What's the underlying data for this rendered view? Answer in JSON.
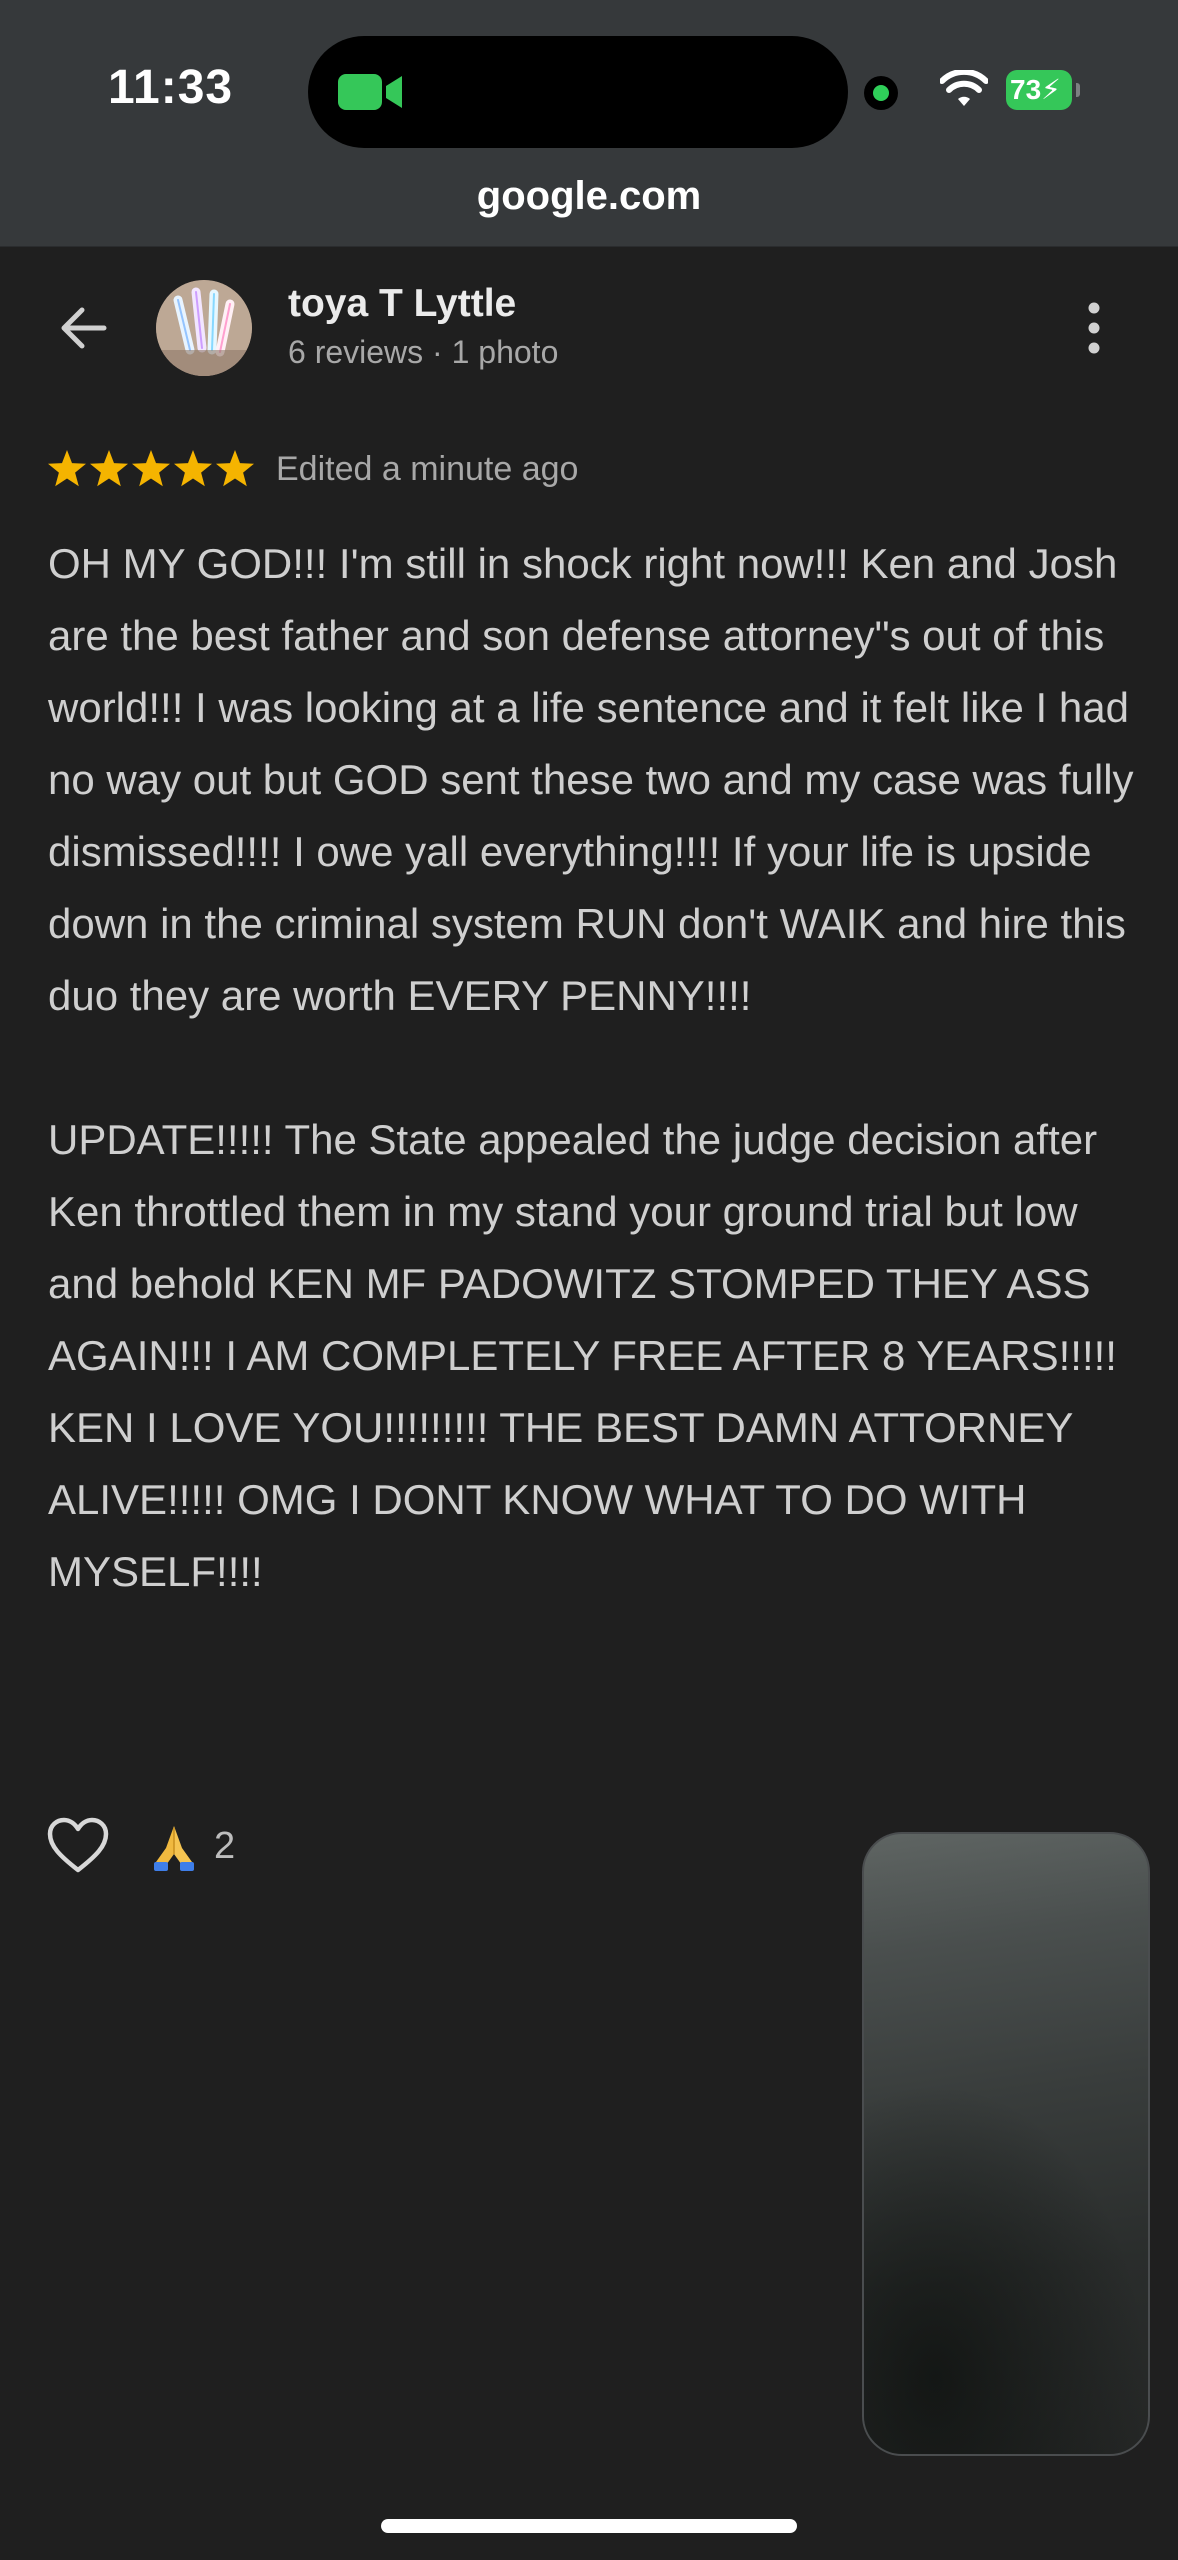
{
  "status_bar": {
    "time": "11:33",
    "battery": "73"
  },
  "browser": {
    "url": "google.com"
  },
  "reviewer": {
    "name": "toya T Lyttle",
    "meta": "6 reviews · 1 photo"
  },
  "review": {
    "rating": 5,
    "rating_max": 5,
    "edited": "Edited a minute ago",
    "text": "OH MY GOD!!! I'm still in shock right now!!! Ken and Josh are the best father and son defense attorney\"s out of this world!!! I was looking at a life sentence and it felt like I had no way out but GOD sent these two and my case was fully dismissed!!!! I owe yall everything!!!! If your life is upside down in the criminal system RUN don't WAIK and hire this duo they are worth EVERY PENNY!!!!\n\nUPDATE!!!!! The State appealed the judge decision after Ken throttled them in my stand your ground trial but low and behold KEN MF PADOWITZ STOMPED THEY ASS AGAIN!!! I AM COMPLETELY FREE AFTER 8 YEARS!!!!! KEN I LOVE YOU!!!!!!!!! THE BEST DAMN ATTORNEY ALIVE!!!!! OMG I DONT KNOW WHAT TO DO WITH MYSELF!!!!"
  },
  "reactions": {
    "count": "2",
    "emoji_icon": "folded-hands-icon"
  },
  "colors": {
    "star": "#f5b400",
    "chrome": "#36393b",
    "background": "#1f1f1f",
    "facetime_green": "#35c759"
  }
}
